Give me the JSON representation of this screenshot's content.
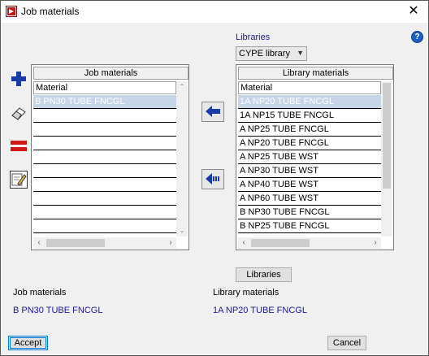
{
  "window": {
    "title": "Job materials"
  },
  "libraries": {
    "label": "Libraries",
    "selected": "CYPE library",
    "button_label": "Libraries"
  },
  "job_panel": {
    "header": "Job materials",
    "column": "Material",
    "rows": [
      "B PN30 TUBE FNCGL",
      "",
      "",
      "",
      "",
      "",
      "",
      "",
      "",
      ""
    ]
  },
  "library_panel": {
    "header": "Library materials",
    "column": "Material",
    "rows": [
      "1A NP20 TUBE FNCGL",
      "1A NP15 TUBE FNCGL",
      "A NP25 TUBE FNCGL",
      "A NP20 TUBE FNCGL",
      "A NP25 TUBE WST",
      "A NP30 TUBE WST",
      "A NP40 TUBE WST",
      "A NP60 TUBE WST",
      "B NP30 TUBE FNCGL",
      "B NP25 TUBE FNCGL"
    ]
  },
  "summary": {
    "job_label": "Job materials",
    "job_value": "B PN30 TUBE FNCGL",
    "library_label": "Library materials",
    "library_value": "1A NP20 TUBE FNCGL"
  },
  "footer": {
    "accept": "Accept",
    "cancel": "Cancel"
  },
  "icons": {
    "app": "app-logo-icon",
    "close": "close-icon",
    "help": "help-icon",
    "add": "plus-icon",
    "erase": "eraser-icon",
    "equal": "equal-icon",
    "edit": "edit-icon",
    "move": "arrow-left-icon",
    "move_all": "arrow-left-dotted-icon"
  },
  "colors": {
    "accent": "#0078d7",
    "label_blue": "#1a1a9a",
    "selection": "#c8d4e8"
  }
}
